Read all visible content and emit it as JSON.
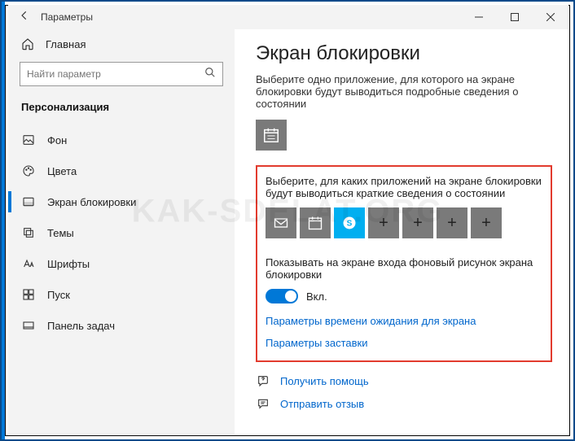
{
  "window": {
    "title": "Параметры"
  },
  "sidebar": {
    "home": "Главная",
    "search_placeholder": "Найти параметр",
    "section": "Персонализация",
    "items": [
      {
        "label": "Фон"
      },
      {
        "label": "Цвета"
      },
      {
        "label": "Экран блокировки"
      },
      {
        "label": "Темы"
      },
      {
        "label": "Шрифты"
      },
      {
        "label": "Пуск"
      },
      {
        "label": "Панель задач"
      }
    ]
  },
  "main": {
    "heading": "Экран блокировки",
    "detailed_desc": "Выберите одно приложение, для которого на экране блокировки будут выводиться подробные сведения о состоянии",
    "quick_desc": "Выберите, для каких приложений на экране блокировки будут выводиться краткие сведения о состоянии",
    "toggle_label": "Показывать на экране входа фоновый рисунок экрана блокировки",
    "toggle_state": "Вкл.",
    "link_timeout": "Параметры времени ожидания для экрана",
    "link_screensaver": "Параметры заставки",
    "quick_tiles": [
      {
        "type": "mail"
      },
      {
        "type": "calendar"
      },
      {
        "type": "skype"
      },
      {
        "type": "add"
      },
      {
        "type": "add"
      },
      {
        "type": "add"
      },
      {
        "type": "add"
      }
    ]
  },
  "footer": {
    "help": "Получить помощь",
    "feedback": "Отправить отзыв"
  },
  "watermark": "KAK-SDELAT.ORG"
}
